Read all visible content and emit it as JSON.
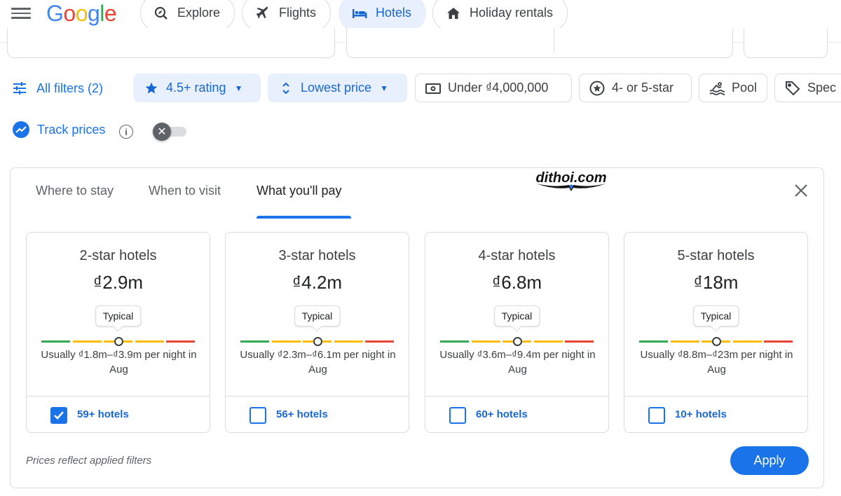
{
  "header": {
    "logo_letters": [
      "G",
      "o",
      "o",
      "g",
      "l",
      "e"
    ],
    "logo_colors": [
      "#4285F4",
      "#EA4335",
      "#FBBC05",
      "#4285F4",
      "#34A853",
      "#EA4335"
    ],
    "tabs": [
      {
        "label": "Explore",
        "icon": "explore-icon"
      },
      {
        "label": "Flights",
        "icon": "airplane-icon"
      },
      {
        "label": "Hotels",
        "icon": "bed-icon",
        "active": true
      },
      {
        "label": "Holiday rentals",
        "icon": "house-icon"
      }
    ]
  },
  "filters": {
    "all_filters": "All filters (2)",
    "chips": [
      {
        "label": "4.5+ rating",
        "icon": "star-icon",
        "active": true
      },
      {
        "label": "Lowest price",
        "icon": "sort-icon",
        "active": true
      },
      {
        "label": "Under ₫4,000,000",
        "icon": "cash-icon"
      },
      {
        "label": "4- or 5-star",
        "icon": "star-circle-icon"
      },
      {
        "label": "Pool",
        "icon": "pool-icon"
      },
      {
        "label": "Spec",
        "icon": "tag-icon"
      }
    ]
  },
  "track": {
    "label": "Track prices",
    "enabled": false
  },
  "panel": {
    "tabs": [
      "Where to stay",
      "When to visit",
      "What you'll pay"
    ],
    "active_tab": "What you'll pay",
    "watermark": "dithoi.com",
    "cards": [
      {
        "title": "2-star hotels",
        "price": "₫2.9m",
        "badge": "Typical",
        "range": "Usually ₫1.8m–₫3.9m per night in Aug",
        "count": "59+ hotels",
        "checked": true
      },
      {
        "title": "3-star hotels",
        "price": "₫4.2m",
        "badge": "Typical",
        "range": "Usually ₫2.3m–₫6.1m per night in Aug",
        "count": "56+ hotels",
        "checked": false
      },
      {
        "title": "4-star hotels",
        "price": "₫6.8m",
        "badge": "Typical",
        "range": "Usually ₫3.6m–₫9.4m per night in Aug",
        "count": "60+ hotels",
        "checked": false
      },
      {
        "title": "5-star hotels",
        "price": "₫18m",
        "badge": "Typical",
        "range": "Usually ₫8.8m–₫23m per night in Aug",
        "count": "10+ hotels",
        "checked": false
      }
    ],
    "scale_colors": [
      "#34a853",
      "#fbbc04",
      "#fbbc04",
      "#fbbc04",
      "#ea4335"
    ],
    "note": "Prices reflect applied filters",
    "apply": "Apply"
  }
}
